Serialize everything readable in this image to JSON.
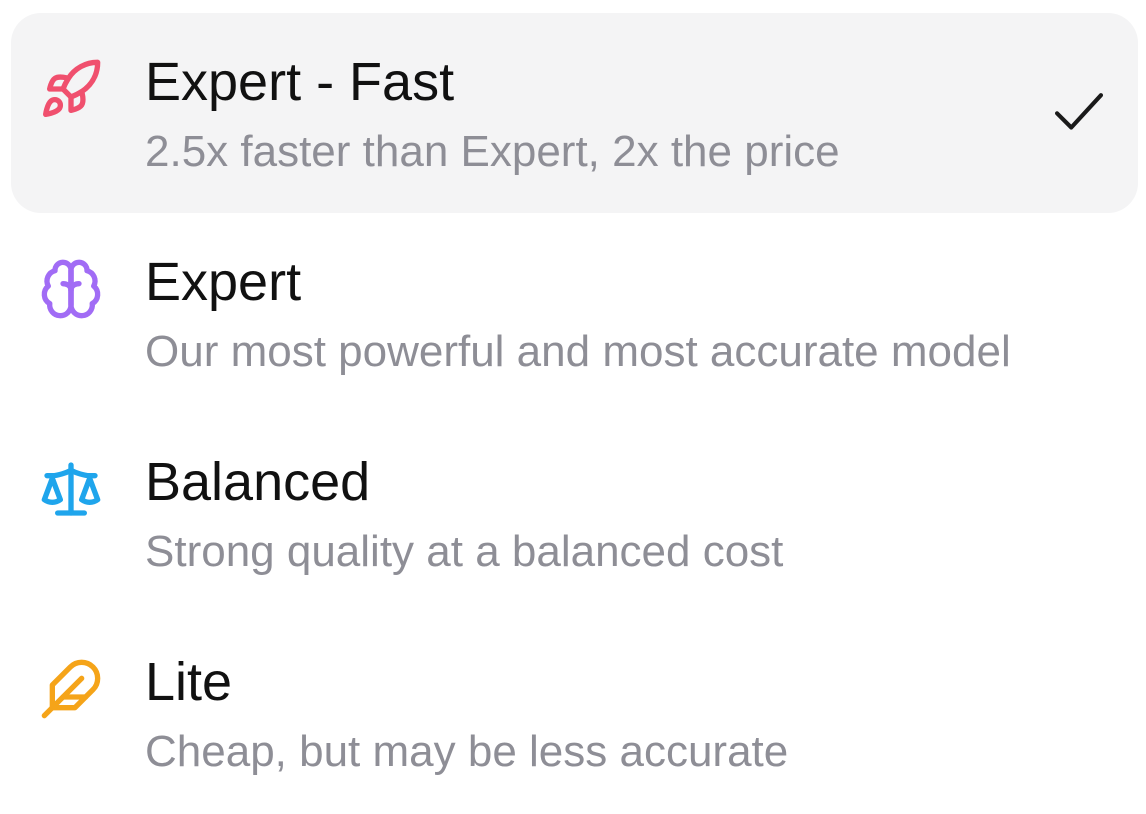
{
  "options": [
    {
      "title": "Expert - Fast",
      "description": "2.5x faster than Expert, 2x the price",
      "icon": "rocket-icon",
      "color": "#f0506e",
      "selected": true
    },
    {
      "title": "Expert",
      "description": "Our most powerful and most accurate model",
      "icon": "brain-icon",
      "color": "#a16cf5",
      "selected": false
    },
    {
      "title": "Balanced",
      "description": "Strong quality at a balanced cost",
      "icon": "scale-icon",
      "color": "#1fa5ec",
      "selected": false
    },
    {
      "title": "Lite",
      "description": "Cheap, but may be less accurate",
      "icon": "feather-icon",
      "color": "#f5a419",
      "selected": false
    }
  ],
  "checkmark_icon": "check-icon"
}
